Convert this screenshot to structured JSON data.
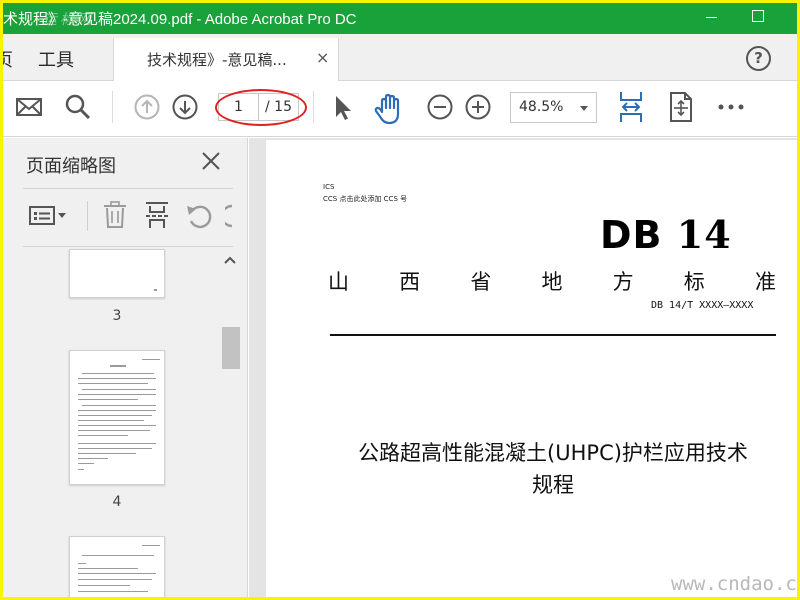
{
  "window": {
    "title": "术规程》-意见稿2024.09.pdf - Adobe Acrobat Pro DC",
    "watermark": "运标网"
  },
  "tabs": {
    "home_label": "页",
    "tools_label": "工具",
    "document_label": "技术规程》-意见稿...",
    "close_glyph": "×",
    "help_glyph": "?"
  },
  "toolbar": {
    "page_current": "1",
    "page_total": "/ 15",
    "zoom": "48.5%"
  },
  "panel": {
    "title": "页面缩略图",
    "thumbnails": [
      {
        "label": "3"
      },
      {
        "label": "4"
      }
    ]
  },
  "document": {
    "ics": "ICS",
    "ccs": "CCS  点击此处添加 CCS 号",
    "db_prefix": "DB",
    "db_number": "14",
    "province": [
      "山",
      "西",
      "省",
      "地",
      "方",
      "标",
      "准"
    ],
    "standard_number": "DB 14/T XXXX—XXXX",
    "title_line1": "公路超高性能混凝土(UHPC)护栏应用技术",
    "title_line2": "规程"
  },
  "overlay": {
    "site_watermark": "www.cndao.com"
  },
  "colors": {
    "titlebar": "#19a13a",
    "border": "#f8f300",
    "accent_blue": "#2d6db8",
    "annotation_red": "#e12020"
  }
}
